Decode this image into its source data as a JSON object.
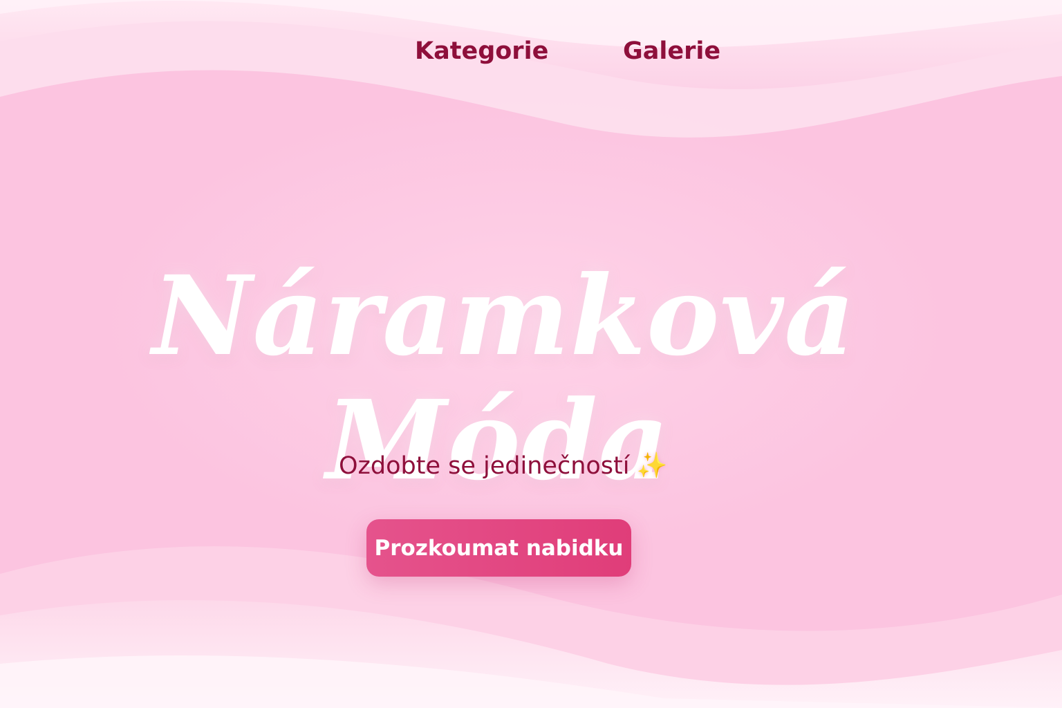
{
  "nav": {
    "items": [
      {
        "label": "Kategorie"
      },
      {
        "label": "Galerie"
      }
    ]
  },
  "hero": {
    "title_line1": "Náramková",
    "title_line2": "Móda",
    "subtitle": "Ozdobte se jedinečností",
    "subtitle_icon": "sparkles-icon",
    "cta_label": "Prozkoumat nabidku"
  },
  "colors": {
    "background": "#fcc4e0",
    "nav_text": "#8e0f3b",
    "title_text": "#ffffff",
    "button_start": "#e5538c",
    "button_end": "#e03d79"
  }
}
